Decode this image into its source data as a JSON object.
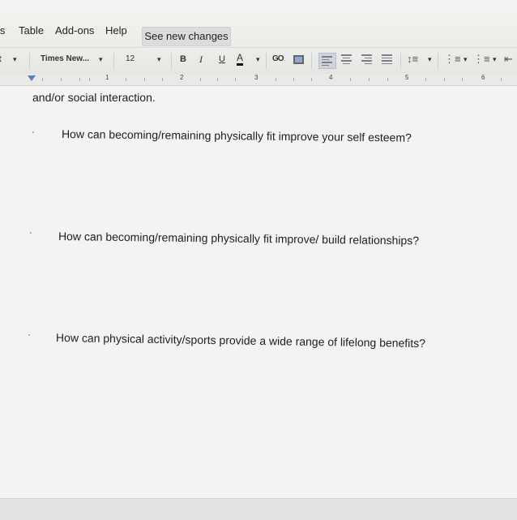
{
  "menu": {
    "partial_item": "ls",
    "table": "Table",
    "addons": "Add-ons",
    "help": "Help",
    "see_new_changes": "See new changes"
  },
  "toolbar": {
    "style_partial": "t",
    "font": "Times New...",
    "font_size": "12",
    "bold": "B",
    "italic": "I",
    "underline": "U",
    "text_color": "A",
    "link": "GO"
  },
  "ruler": {
    "numbers": [
      "1",
      "2",
      "3",
      "4",
      "5",
      "6"
    ]
  },
  "document": {
    "intro_fragment": "and/or social interaction.",
    "questions": [
      "How can becoming/remaining physically fit improve your self esteem?",
      "How can becoming/remaining physically fit improve/ build relationships?",
      "How can physical activity/sports provide a wide range of lifelong benefits?"
    ]
  }
}
